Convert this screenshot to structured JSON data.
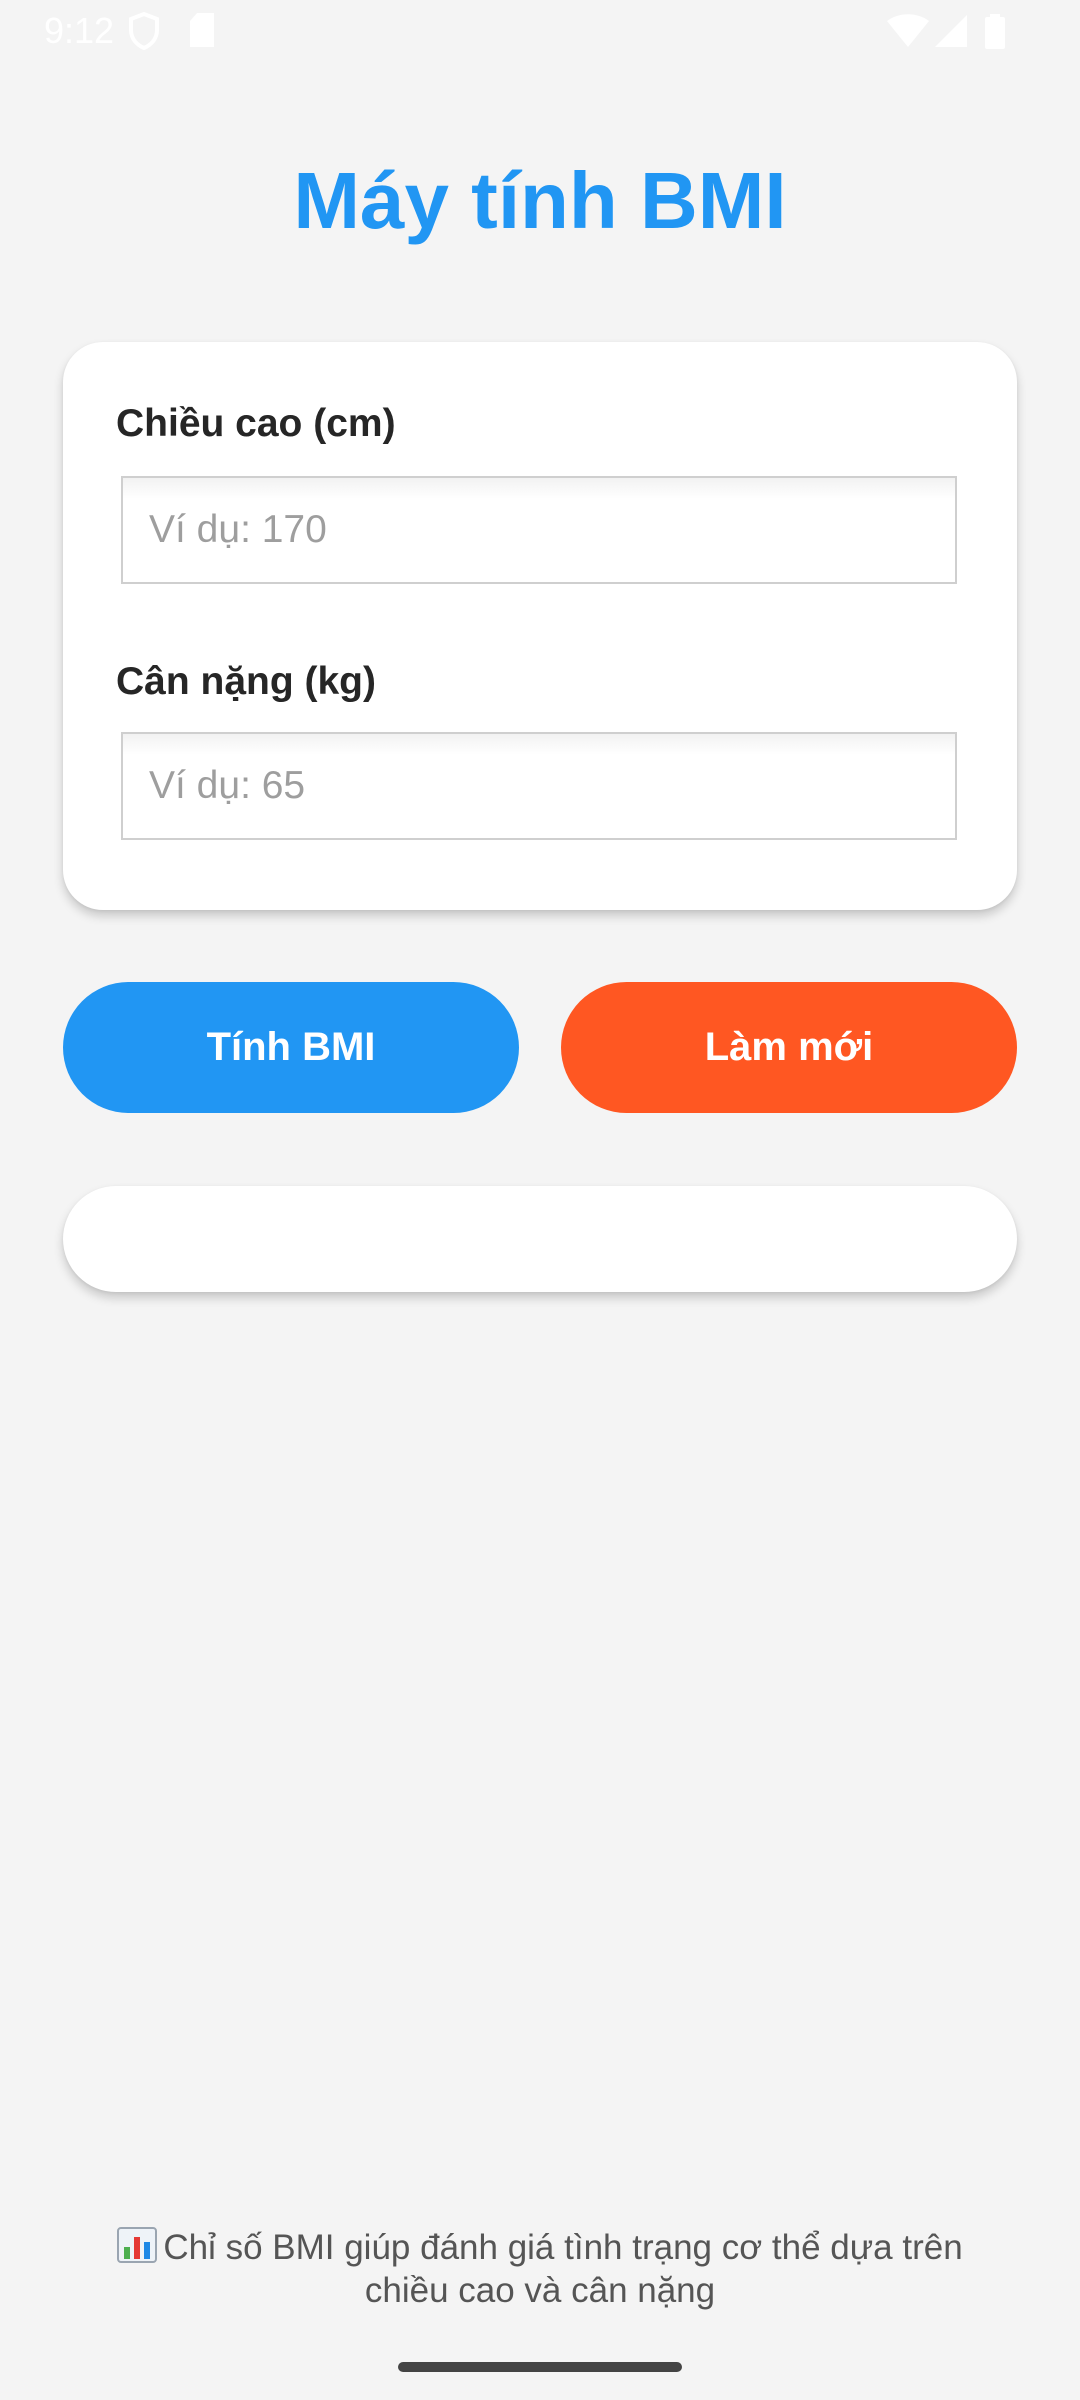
{
  "status_bar": {
    "time": "9:12",
    "icons_left": [
      "shield-icon",
      "sd-card-icon"
    ],
    "icons_right": [
      "wifi-icon",
      "cellular-signal-icon",
      "battery-icon"
    ]
  },
  "app": {
    "title": "Máy tính BMI",
    "accent_color": "#2196f3",
    "reset_color": "#ff5722"
  },
  "form": {
    "height_label": "Chiều cao (cm)",
    "height_value": "",
    "height_placeholder": "Ví dụ: 170",
    "weight_label": "Cân nặng (kg)",
    "weight_value": "",
    "weight_placeholder": "Ví dụ: 65"
  },
  "actions": {
    "calculate_label": "Tính BMI",
    "reset_label": "Làm mới"
  },
  "result": {
    "text": ""
  },
  "footer": {
    "icon": "bar-chart-icon",
    "note": "Chỉ số BMI giúp đánh giá tình trạng cơ thể dựa trên chiều cao và cân nặng"
  }
}
